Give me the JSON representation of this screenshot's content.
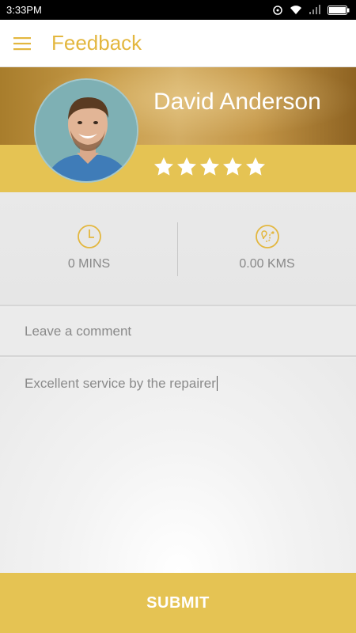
{
  "status_bar": {
    "time": "3:33PM"
  },
  "header": {
    "title": "Feedback",
    "menu_icon": "hamburger-menu-icon"
  },
  "profile": {
    "name": "David Anderson",
    "rating": 5,
    "max_rating": 5
  },
  "stats": {
    "duration": {
      "icon": "clock-icon",
      "value": "0 MINS"
    },
    "distance": {
      "icon": "route-map-icon",
      "value": "0.00 KMS"
    }
  },
  "comment": {
    "label": "Leave a comment",
    "value": "Excellent service by the repairer"
  },
  "submit": {
    "label": "SUBMIT"
  },
  "colors": {
    "accent": "#e3b73f",
    "band": "#e5c353",
    "text_muted": "#8a8a8a"
  }
}
